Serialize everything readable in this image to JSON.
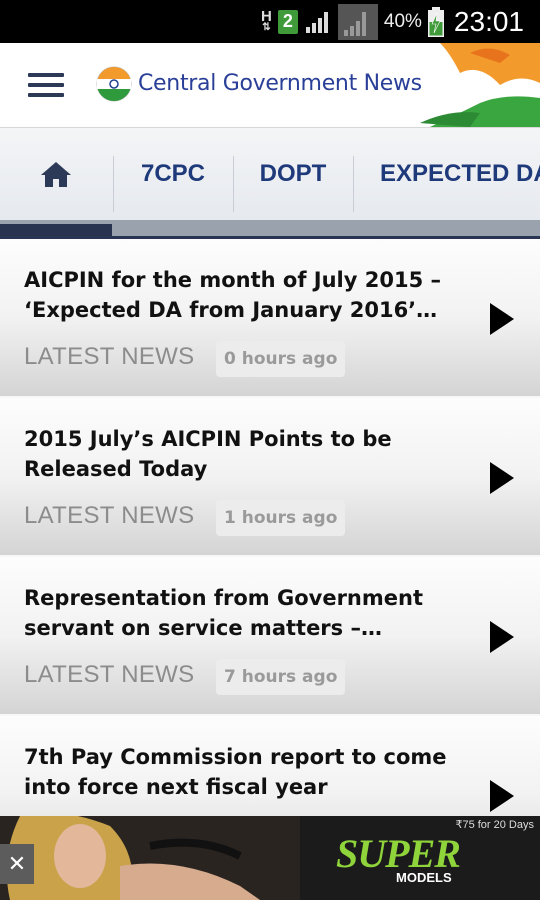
{
  "status_bar": {
    "network": "H",
    "sim": "2",
    "battery_percent": "40%",
    "time": "23:01"
  },
  "app_bar": {
    "title": "Central Government News"
  },
  "tabs": [
    {
      "label": "7CPC"
    },
    {
      "label": "DOPT"
    },
    {
      "label": "EXPECTED DA"
    }
  ],
  "news": [
    {
      "title": "AICPIN for the month of July 2015 – ‘Expected DA from January 2016’…",
      "category": "LATEST NEWS",
      "time": "0 hours ago"
    },
    {
      "title": "2015 July’s AICPIN Points to be Released Today",
      "category": "LATEST NEWS",
      "time": "1 hours ago"
    },
    {
      "title": "Representation from Government servant on service matters –…",
      "category": "LATEST NEWS",
      "time": "7 hours ago"
    },
    {
      "title": "7th Pay Commission report to come into force next fiscal year",
      "category": "",
      "time": ""
    }
  ],
  "ad": {
    "price_text": "₹75 for 20 Days",
    "brand": "SUPER",
    "sub": "MODELS",
    "close": "✕"
  },
  "colors": {
    "accent": "#1f3a7a",
    "title": "#2a3f97",
    "ad_green": "#8fd43a"
  }
}
